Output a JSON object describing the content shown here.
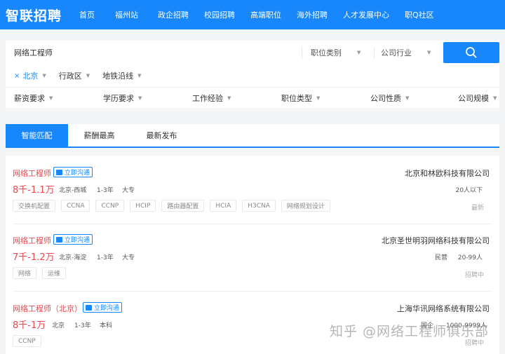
{
  "header": {
    "logo": "智联招聘",
    "nav": [
      "首页",
      "福州站",
      "政企招聘",
      "校园招聘",
      "高端职位",
      "海外招聘",
      "人才发展中心",
      "职Q社区"
    ]
  },
  "search": {
    "keyword": "网络工程师",
    "job_category": "职位类别",
    "industry": "公司行业"
  },
  "location": {
    "city": "北京",
    "district": "行政区",
    "metro": "地铁沿线"
  },
  "filters": [
    "薪资要求",
    "学历要求",
    "工作经验",
    "职位类型",
    "公司性质",
    "公司规模"
  ],
  "tabs": [
    "智能匹配",
    "薪酬最高",
    "最新发布"
  ],
  "jobs": [
    {
      "title": "网络工程师",
      "chat": "立即沟通",
      "salary": "8千-1.1万",
      "location": "北京-西城",
      "experience": "1-3年",
      "education": "大专",
      "tags": [
        "交换机配置",
        "CCNA",
        "CCNP",
        "HCIP",
        "路由器配置",
        "HCIA",
        "H3CNA",
        "网络规划设计"
      ],
      "company": "北京和林欧科技有限公司",
      "company_type": "",
      "company_size": "20人以下",
      "status": "最新"
    },
    {
      "title": "网络工程师",
      "chat": "立即沟通",
      "salary": "7千-1.2万",
      "location": "北京-海淀",
      "experience": "1-3年",
      "education": "大专",
      "tags": [
        "网络",
        "运维"
      ],
      "company": "北京圣世明羽网络科技有限公司",
      "company_type": "民营",
      "company_size": "20-99人",
      "status": "招聘中"
    },
    {
      "title": "网络工程师（北京）",
      "chat": "立即沟通",
      "salary": "8千-1万",
      "location": "北京",
      "experience": "1-3年",
      "education": "本科",
      "tags": [
        "CCNP"
      ],
      "company": "上海华讯网络系统有限公司",
      "company_type": "国企",
      "company_size": "1000-9999人",
      "status": "招聘中"
    }
  ],
  "watermark": "知乎 @网络工程师俱乐部",
  "colors": {
    "brand": "#1787fb",
    "salary": "#e8484f"
  },
  "icons": {
    "search": "search-icon",
    "chat": "chat-icon",
    "dropdown": "caret-down-icon",
    "remove": "close-icon"
  }
}
